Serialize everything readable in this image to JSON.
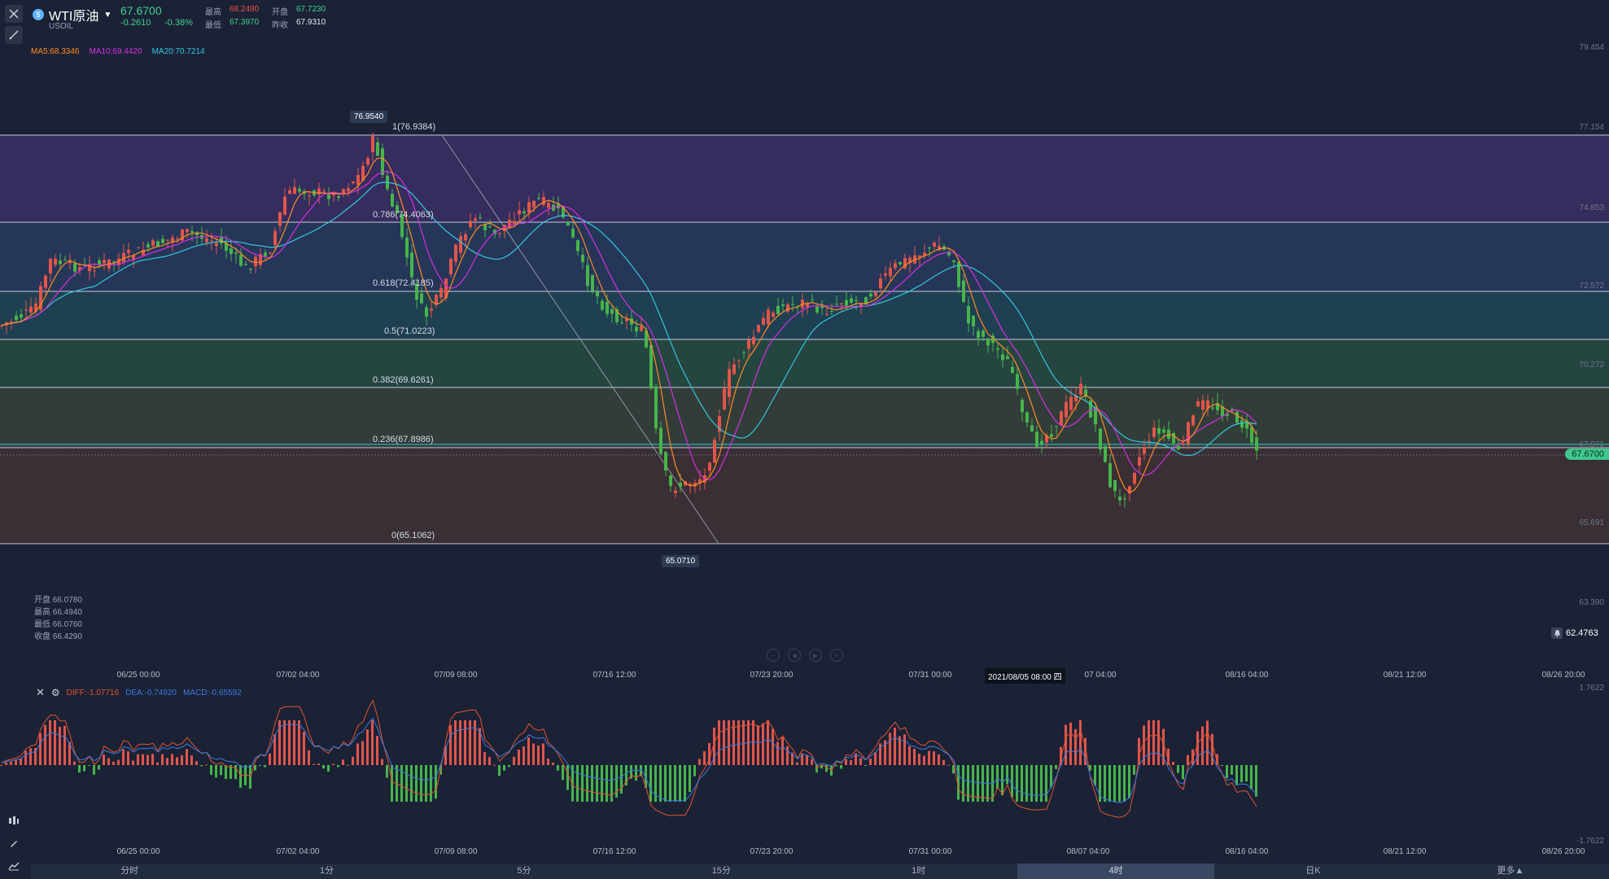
{
  "symbol": {
    "name": "WTI原油",
    "code": "USOIL",
    "price": "67.6700",
    "change": "-0.2610",
    "change_pct": "-0.38%",
    "stats": {
      "high_label": "最高",
      "high": "68.2480",
      "open_label": "开盘",
      "open": "67.7230",
      "low_label": "最低",
      "low": "67.3970",
      "prev_close_label": "昨收",
      "prev_close": "67.9310"
    }
  },
  "ma_legend": {
    "ma5": "MA5:68.3346",
    "ma10": "MA10:69.4420",
    "ma20": "MA20:70.7214"
  },
  "y_axis_main": [
    "79.454",
    "77.154",
    "74.853",
    "72.572",
    "70.272",
    "67.971",
    "65.691",
    "63.390"
  ],
  "current_price_tag": "67.6700",
  "alert_price": "62.4763",
  "fib_labels": [
    "1(76.9384)",
    "0.786(74.4063)",
    "0.618(72.4185)",
    "0.5(71.0223)",
    "0.382(69.6261)",
    "0.236(67.8986)",
    "0(65.1062)"
  ],
  "high_tag": "76.9540",
  "low_tag": "65.0710",
  "x_axis_main": [
    "06/25 00:00",
    "07/02 04:00",
    "07/09 08:00",
    "07/16 12:00",
    "07/23 20:00",
    "07/31 00:00",
    "07 04:00",
    "08/16 04:00",
    "08/21 12:00",
    "08/26 20:00"
  ],
  "crosshair_time": "2021/08/05 08:00 四",
  "ohlc": {
    "open": "开盘 66.0780",
    "high": "最高 66.4940",
    "low": "最低 66.0760",
    "close": "收盘 66.4290"
  },
  "macd_legend": {
    "dif": "DIFF:-1.07716",
    "dea": "DEA:-0.74920",
    "macd": "MACD:-0.65592"
  },
  "y_axis_macd": [
    "1.7622",
    "-1.7622"
  ],
  "x_axis_macd": [
    "06/25 00:00",
    "07/02 04:00",
    "07/09 08:00",
    "07/16 12:00",
    "07/23 20:00",
    "07/31 00:00",
    "08/07 04:00",
    "08/16 04:00",
    "08/21 12:00",
    "08/26 20:00"
  ],
  "timeframes": [
    "分时",
    "1分",
    "5分",
    "15分",
    "1时",
    "4时",
    "日K",
    "更多▲"
  ],
  "active_timeframe": "4时",
  "colors": {
    "up": "#e2554a",
    "down": "#46b54a",
    "ma5": "#ff8a24",
    "ma10": "#d52fe0",
    "ma20": "#33c7dd",
    "dif": "#e4532f",
    "dea": "#3d7be0",
    "accent": "#3fd28f"
  }
}
